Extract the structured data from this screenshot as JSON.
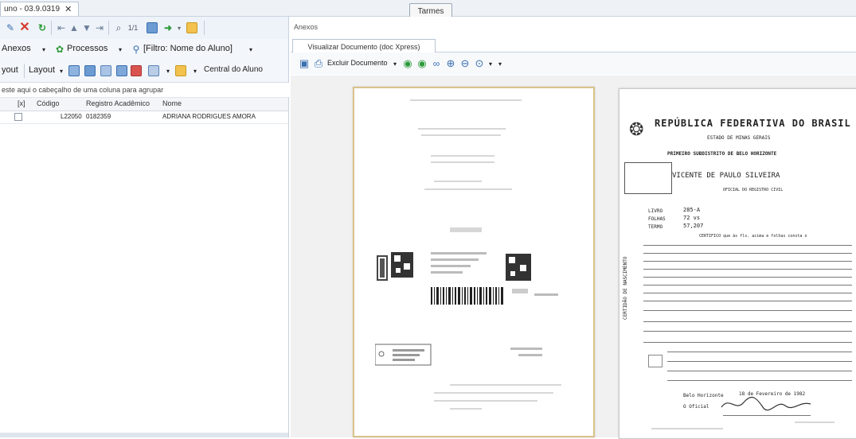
{
  "top_tab": {
    "title": "uno - 03.9.0319",
    "close": "✕"
  },
  "tools_button": "Tarmes",
  "left": {
    "toolbar2": {
      "anexos": "Anexos",
      "processos": "Processos",
      "filter": "[Filtro: Nome do Aluno]"
    },
    "toolbar3": {
      "layout1": "yout",
      "layout2": "Layout",
      "central": "Central do Aluno"
    },
    "group_hint": "este aqui o cabeçalho de uma coluna para agrupar",
    "columns": [
      "[x]",
      "Código",
      "Registro Acadêmico",
      "Nome"
    ],
    "rows": [
      {
        "codigo": "L22050",
        "registro": "0182359",
        "nome": "ADRIANA RODRIGUES AMORA"
      }
    ]
  },
  "right": {
    "title": "Anexos",
    "tab": "Visualizar Documento (doc Xpress)",
    "toolbar": {
      "delete_label": "Excluir Documento"
    }
  },
  "certidao": {
    "republica": "REPÚBLICA FEDERATIVA DO BRASIL",
    "estado": "ESTADO DE MINAS GERAIS",
    "subdistrito": "PRIMEIRO SUBDISTRITO DE BELO HORIZONTE",
    "nome_oficial": "VICENTE DE PAULO SILVEIRA",
    "cargo": "OFICIAL DO REGISTRO CIVIL",
    "livro_label": "LIVRO",
    "livro": "285-A",
    "folhas_label": "FOLHAS",
    "folhas": "72 vs",
    "termo_label": "TERMO",
    "termo": "57,207",
    "certifico": "CERTIFICO que às fls. acima e folhas consta o",
    "side_label": "CERTIDÃO DE NASCIMENTO",
    "bairro": "Belo Horizonte",
    "oficial_label": "O Oficial",
    "data": "18 de Fevereiro de 1982"
  },
  "colors": {
    "accent": "#2f6fb8",
    "tab_bg": "#eef3f9",
    "page_border": "#d9c28a"
  }
}
